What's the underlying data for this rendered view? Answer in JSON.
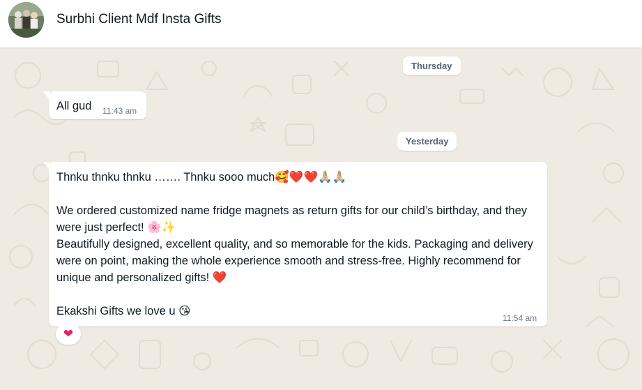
{
  "header": {
    "chat_name": "Surbhi Client Mdf Insta Gifts"
  },
  "dates": {
    "first": "Thursday",
    "second": "Yesterday"
  },
  "messages": [
    {
      "text": "All gud",
      "time": "11:43 am"
    },
    {
      "line1": "Thnku thnku thnku ……. Thnku sooo much🥰❤️❤️🙏🏼🙏🏼",
      "para2": "We ordered customized name fridge magnets as return gifts for our child’s birthday, and they were just perfect! 🌸✨\nBeautifully designed, excellent quality, and so memorable for the kids. Packaging and delivery were on point, making the whole experience smooth and stress-free. Highly recommend for unique and personalized gifts! ❤️",
      "para3": "Ekakshi Gifts we love u 😘",
      "time": "11:54 am",
      "reaction": "❤"
    }
  ],
  "colors": {
    "wallpaper": "#efeae2",
    "bubble": "#ffffff",
    "timestamp": "#667781",
    "reaction_heart": "#e0245e"
  },
  "icons": {
    "reaction": "heart-icon",
    "avatar": "group-photo-avatar"
  }
}
